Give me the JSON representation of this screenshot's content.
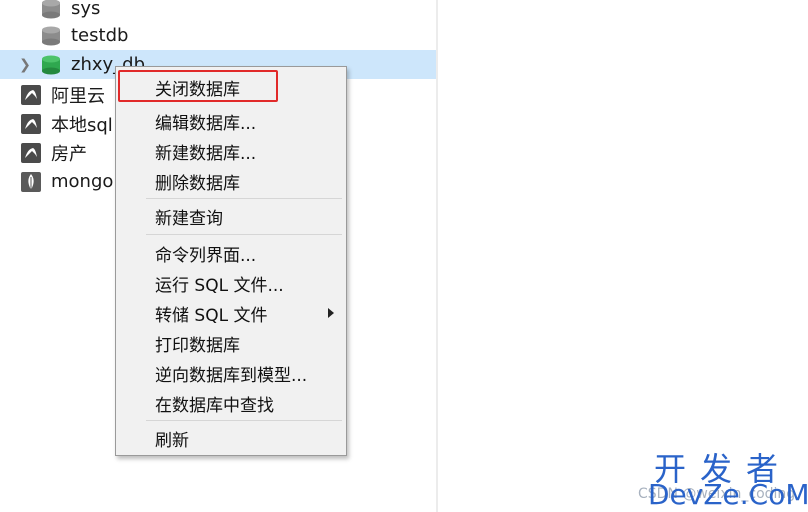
{
  "tree": {
    "databases": [
      {
        "name": "sys",
        "icon": "database-icon-gray"
      },
      {
        "name": "testdb",
        "icon": "database-icon-gray"
      },
      {
        "name": "zhxy_db",
        "icon": "database-icon-green",
        "selected": true
      }
    ],
    "connections": [
      {
        "name": "阿里云",
        "icon": "mysql-connection-icon"
      },
      {
        "name": "本地sql",
        "icon": "mysql-connection-icon"
      },
      {
        "name": "房产",
        "icon": "mysql-connection-icon"
      },
      {
        "name": "mongo",
        "icon": "mongodb-connection-icon"
      }
    ]
  },
  "context_menu": {
    "items": [
      {
        "label": "关闭数据库",
        "highlighted": true
      },
      {
        "label": "编辑数据库..."
      },
      {
        "label": "新建数据库..."
      },
      {
        "label": "删除数据库"
      },
      {
        "label": "新建查询"
      },
      {
        "label": "命令列界面..."
      },
      {
        "label": "运行 SQL 文件..."
      },
      {
        "label": "转储 SQL 文件",
        "submenu": true
      },
      {
        "label": "打印数据库"
      },
      {
        "label": "逆向数据库到模型..."
      },
      {
        "label": "在数据库中查找"
      },
      {
        "label": "刷新"
      }
    ]
  },
  "watermark": {
    "cn": "开发者",
    "en": "DevZe.CoM",
    "sub": "CSDN @weixin_coding"
  },
  "colors": {
    "selection": "#cde6fb",
    "highlight_border": "#e12a2a",
    "watermark": "#2a63c9",
    "db_green": "#2fa84f",
    "db_gray": "#8c8c8c"
  }
}
